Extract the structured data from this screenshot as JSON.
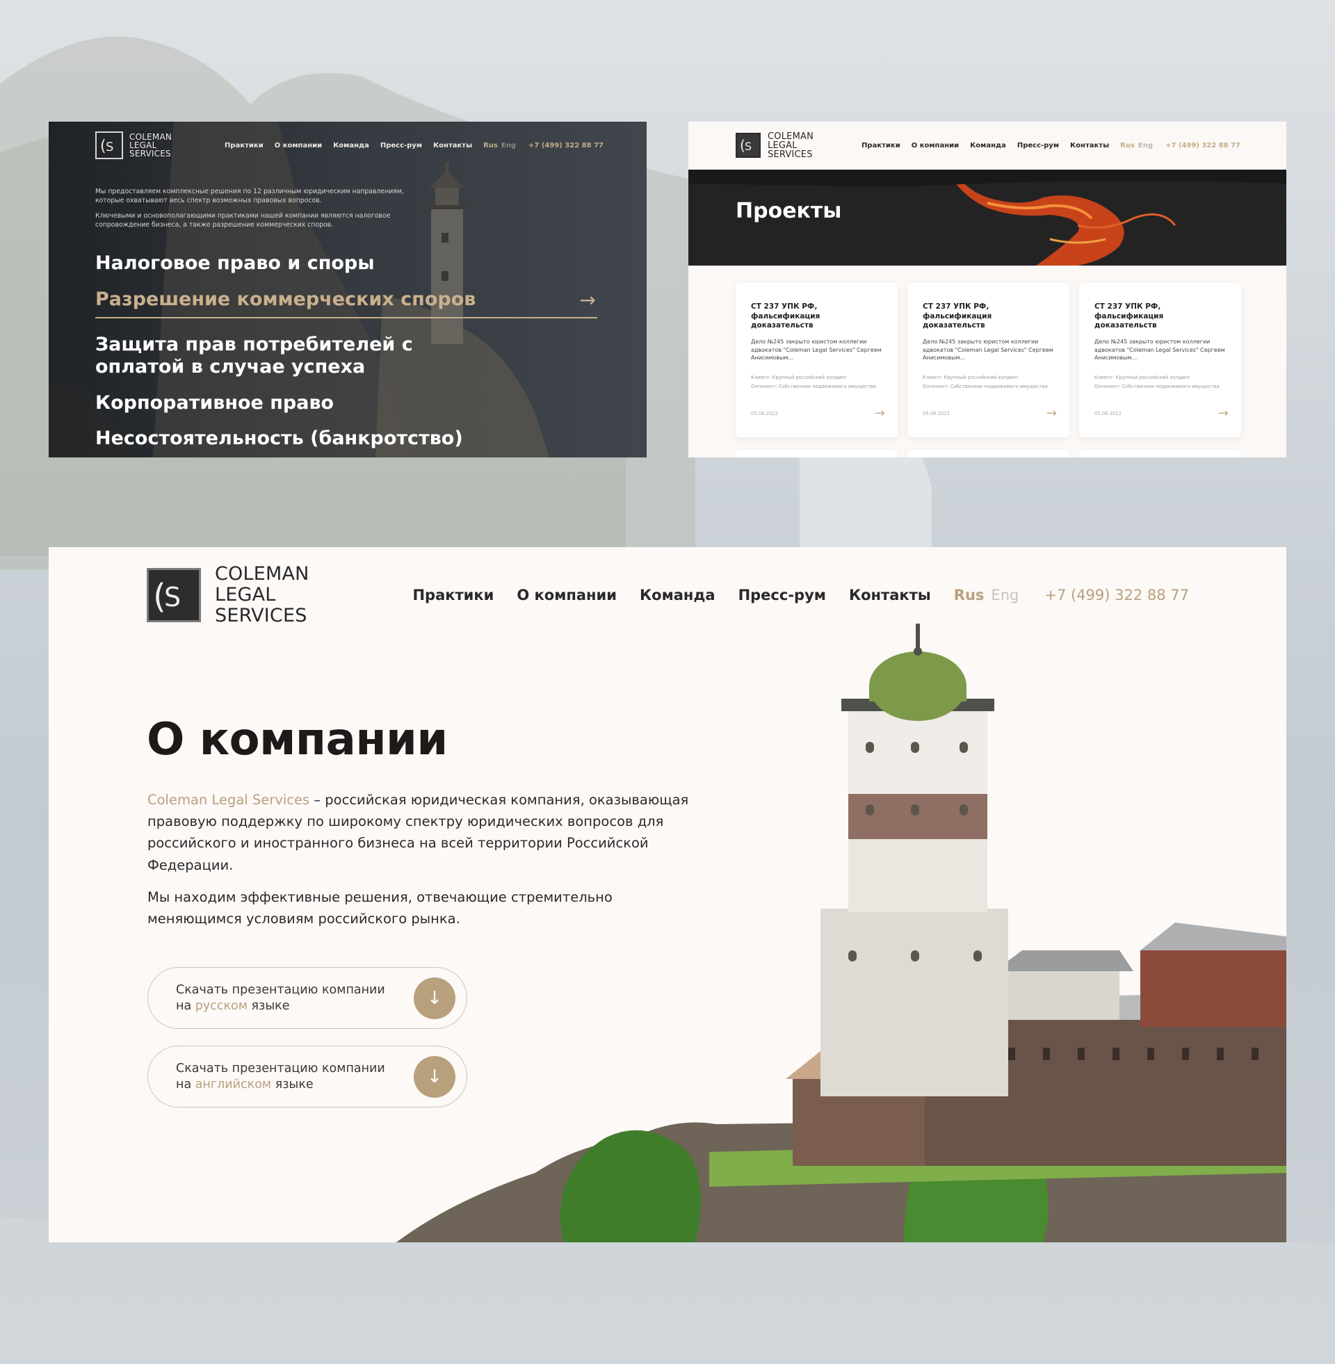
{
  "brand": {
    "name_line1": "COLEMAN",
    "name_line2": "LEGAL",
    "name_line3": "SERVICES",
    "accent_color": "#b9a07d"
  },
  "nav": {
    "items": [
      "Практики",
      "О компании",
      "Команда",
      "Пресс-рум",
      "Контакты"
    ],
    "lang_active": "Rus",
    "lang_inactive": "Eng",
    "phone": "+7 (499) 322 88 77"
  },
  "practices_panel": {
    "intro_1": "Мы предоставляем комплексные решения по 12 различным юридическим направлениям, которые охватывают весь спектр возможных правовых вопросов.",
    "intro_2": "Ключевыми и основополагающими практиками нашей компании являются налоговое сопровождение бизнеса, а также разрешение коммерческих споров.",
    "items": [
      "Налоговое право и споры",
      "Разрешение коммерческих споров",
      "Защита прав потребителей с оплатой в случае успеха",
      "Корпоративное право",
      "Несостоятельность (банкротство)"
    ],
    "active_index": 1,
    "arrow_icon": "→"
  },
  "projects_panel": {
    "title": "Проекты",
    "cards": [
      {
        "title": "СТ 237 УПК РФ, фальсификация доказательств",
        "description": "Дело №245 закрыто юристом коллегии адвокатов \"Coleman Legal Services\" Сергеем Анисимовым...",
        "client": "Клиент: Крупный российский холдинг",
        "opponent": "Оппонент: Собственник недвижимого имущества",
        "date": "05.06.2022"
      },
      {
        "title": "СТ 237 УПК РФ, фальсификация доказательств",
        "description": "Дело №245 закрыто юристом коллегии адвокатов \"Coleman Legal Services\" Сергеем Анисимовым...",
        "client": "Клиент: Крупный российский холдинг",
        "opponent": "Оппонент: Собственник недвижимого имущества",
        "date": "05.06.2022"
      },
      {
        "title": "СТ 237 УПК РФ, фальсификация доказательств",
        "description": "Дело №245 закрыто юристом коллегии адвокатов \"Coleman Legal Services\" Сергеем Анисимовым...",
        "client": "Клиент: Крупный российский холдинг",
        "opponent": "Оппонент: Собственник недвижимого имущества",
        "date": "05.06.2022"
      }
    ],
    "arrow_icon": "→"
  },
  "about_panel": {
    "title": "О компании",
    "para1_accent": "Coleman Legal Services",
    "para1_rest": " – российская юридическая компания, оказывающая правовую поддержку по широкому спектру юридических вопросов для российского и иностранного бизнеса на всей территории Российской Федерации.",
    "para2": "Мы находим эффективные решения, отвечающие стремительно меняющимся условиям российского рынка.",
    "btn_ru": {
      "line1": "Скачать презентацию компании",
      "prefix": "на ",
      "accent": "русском",
      "suffix": " языке"
    },
    "btn_en": {
      "line1": "Скачать презентацию компании",
      "prefix": "на ",
      "accent": "английском",
      "suffix": " языке"
    },
    "download_icon": "↓"
  }
}
